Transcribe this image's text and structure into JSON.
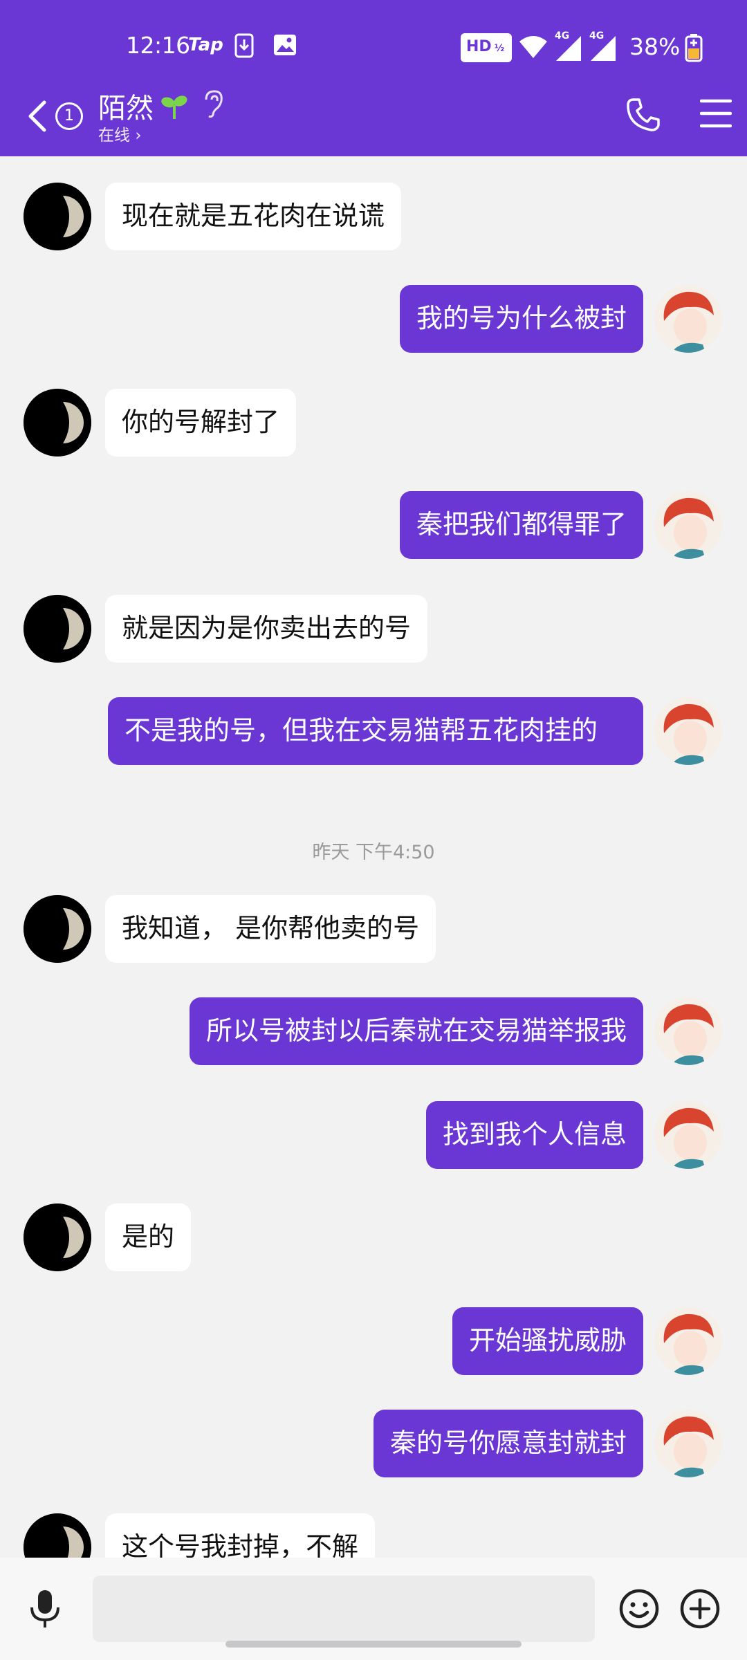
{
  "status_bar": {
    "time": "12:16",
    "tap_label": "Tap",
    "hd_label": "HD",
    "network_1": "4G",
    "network_2": "4G",
    "battery": "38%"
  },
  "header": {
    "back_badge": "1",
    "contact_name": "陌然",
    "presence": "在线",
    "presence_chevron": "›"
  },
  "messages": [
    {
      "side": "in",
      "text": "现在就是五花肉在说谎"
    },
    {
      "side": "out",
      "text": "我的号为什么被封"
    },
    {
      "side": "in",
      "text": "你的号解封了"
    },
    {
      "side": "out",
      "text": "秦把我们都得罪了"
    },
    {
      "side": "in",
      "text": "就是因为是你卖出去的号"
    },
    {
      "side": "out",
      "text": "不是我的号，但我在交易猫帮五花肉挂的"
    },
    {
      "side": "time",
      "text": "昨天 下午4:50"
    },
    {
      "side": "in",
      "text": "我知道， 是你帮他卖的号"
    },
    {
      "side": "out",
      "text": "所以号被封以后秦就在交易猫举报我"
    },
    {
      "side": "out",
      "text": "找到我个人信息"
    },
    {
      "side": "in",
      "text": "是的"
    },
    {
      "side": "out",
      "text": "开始骚扰威胁"
    },
    {
      "side": "out",
      "text": "秦的号你愿意封就封"
    },
    {
      "side": "in",
      "text": "这个号我封掉，不解"
    }
  ],
  "icons": {
    "back": "chevron-left-icon",
    "call": "phone-icon",
    "menu": "hamburger-menu-icon",
    "mic": "microphone-icon",
    "emoji": "smiley-icon",
    "plus": "plus-circle-icon"
  },
  "colors": {
    "accent": "#6a36d4",
    "chat_bg": "#f2f2f3",
    "incoming_bubble": "#ffffff"
  }
}
